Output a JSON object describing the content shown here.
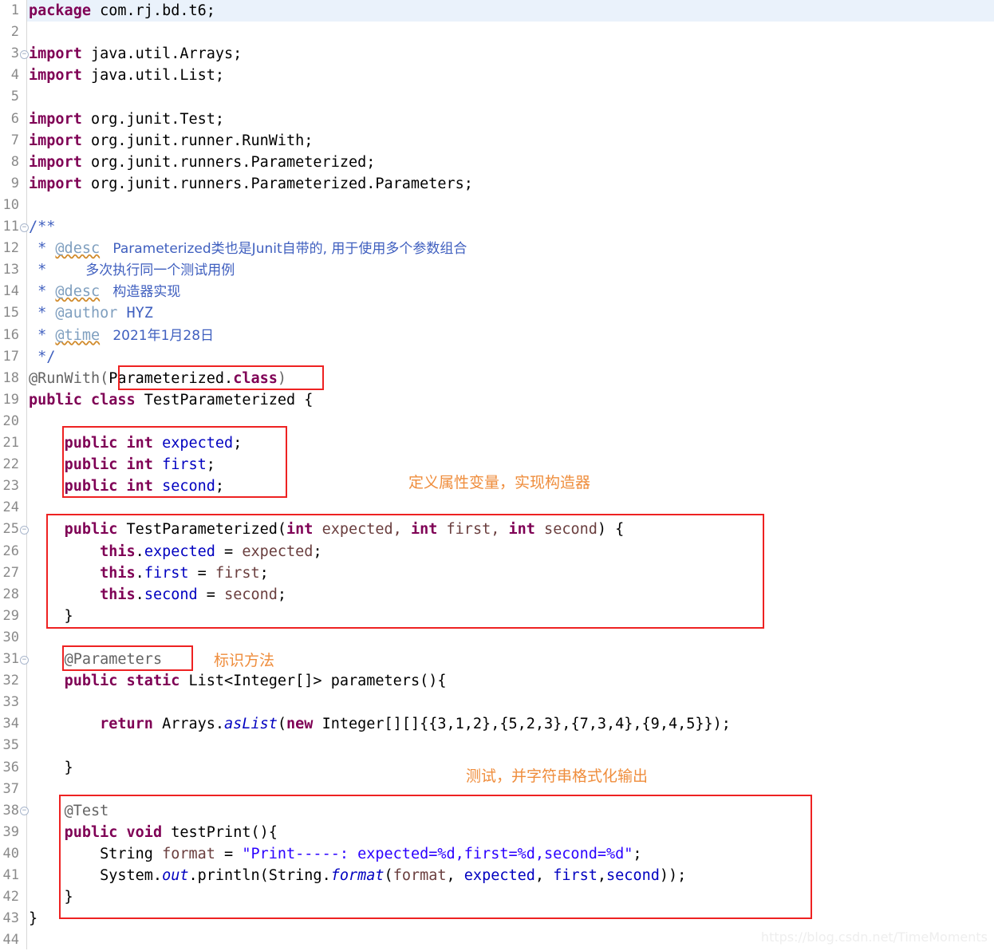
{
  "editor": {
    "language": "java",
    "current_line": 1,
    "total_lines": 44,
    "line_height": 27.1,
    "colors": {
      "keyword": "#7F0055",
      "field": "#0000C0",
      "parameter": "#6A3E3E",
      "string": "#2A00FF",
      "javadoc": "#3F5FBF",
      "javadoc_tag": "#7F9FBF",
      "annotation": "#646464",
      "line_number": "#8A8A8A",
      "current_line_bg": "#EAF2FB",
      "highlight_box": "#EE2222",
      "note_text": "#EF8D3C"
    }
  },
  "line_numbers": [
    1,
    2,
    3,
    4,
    5,
    6,
    7,
    8,
    9,
    10,
    11,
    12,
    13,
    14,
    15,
    16,
    17,
    18,
    19,
    20,
    21,
    22,
    23,
    24,
    25,
    26,
    27,
    28,
    29,
    30,
    31,
    32,
    33,
    34,
    35,
    36,
    37,
    38,
    39,
    40,
    41,
    42,
    43,
    44
  ],
  "fold_markers": [
    3,
    11,
    25,
    31,
    38
  ],
  "code_lines": [
    {
      "n": 1,
      "text": "package com.rj.bd.t6;"
    },
    {
      "n": 2,
      "text": ""
    },
    {
      "n": 3,
      "text": "import java.util.Arrays;"
    },
    {
      "n": 4,
      "text": "import java.util.List;"
    },
    {
      "n": 5,
      "text": ""
    },
    {
      "n": 6,
      "text": "import org.junit.Test;"
    },
    {
      "n": 7,
      "text": "import org.junit.runner.RunWith;"
    },
    {
      "n": 8,
      "text": "import org.junit.runners.Parameterized;"
    },
    {
      "n": 9,
      "text": "import org.junit.runners.Parameterized.Parameters;"
    },
    {
      "n": 10,
      "text": ""
    },
    {
      "n": 11,
      "text": "/**"
    },
    {
      "n": 12,
      "text": " * @desc   Parameterized类也是Junit自带的, 用于使用多个参数组合"
    },
    {
      "n": 13,
      "text": " *        多次执行同一个测试用例"
    },
    {
      "n": 14,
      "text": " * @desc   构造器实现"
    },
    {
      "n": 15,
      "text": " * @author HYZ"
    },
    {
      "n": 16,
      "text": " * @time   2021年1月28日"
    },
    {
      "n": 17,
      "text": " */"
    },
    {
      "n": 18,
      "text": "@RunWith(Parameterized.class)"
    },
    {
      "n": 19,
      "text": "public class TestParameterized {"
    },
    {
      "n": 20,
      "text": ""
    },
    {
      "n": 21,
      "text": "    public int expected;"
    },
    {
      "n": 22,
      "text": "    public int first;"
    },
    {
      "n": 23,
      "text": "    public int second;"
    },
    {
      "n": 24,
      "text": ""
    },
    {
      "n": 25,
      "text": "    public TestParameterized(int expected, int first, int second) {"
    },
    {
      "n": 26,
      "text": "        this.expected = expected;"
    },
    {
      "n": 27,
      "text": "        this.first = first;"
    },
    {
      "n": 28,
      "text": "        this.second = second;"
    },
    {
      "n": 29,
      "text": "    }"
    },
    {
      "n": 30,
      "text": ""
    },
    {
      "n": 31,
      "text": "    @Parameters"
    },
    {
      "n": 32,
      "text": "    public static List<Integer[]> parameters(){"
    },
    {
      "n": 33,
      "text": ""
    },
    {
      "n": 34,
      "text": "        return Arrays.asList(new Integer[][]{{3,1,2},{5,2,3},{7,3,4},{9,4,5}});"
    },
    {
      "n": 35,
      "text": ""
    },
    {
      "n": 36,
      "text": "    }"
    },
    {
      "n": 37,
      "text": ""
    },
    {
      "n": 38,
      "text": "    @Test"
    },
    {
      "n": 39,
      "text": "    public void testPrint(){"
    },
    {
      "n": 40,
      "text": "        String format = \"Print-----: expected=%d,first=%d,second=%d\";"
    },
    {
      "n": 41,
      "text": "        System.out.println(String.format(format, expected, first,second));"
    },
    {
      "n": 42,
      "text": "    }"
    },
    {
      "n": 43,
      "text": "}"
    },
    {
      "n": 44,
      "text": ""
    }
  ],
  "tokens": {
    "l1": {
      "kw": "package",
      "rest": " com.rj.bd.t6;"
    },
    "l3": {
      "kw": "import",
      "rest": " java.util.Arrays;"
    },
    "l4": {
      "kw": "import",
      "rest": " java.util.List;"
    },
    "l6": {
      "kw": "import",
      "rest": " org.junit.Test;"
    },
    "l7": {
      "kw": "import",
      "rest": " org.junit.runner.RunWith;"
    },
    "l8": {
      "kw": "import",
      "rest": " org.junit.runners.Parameterized;"
    },
    "l9": {
      "kw": "import",
      "rest": " org.junit.runners.Parameterized.Parameters;"
    },
    "l11": {
      "open": "/**"
    },
    "l12": {
      "star": " * ",
      "tag": "@desc",
      "body": "   Parameterized类也是Junit自带的, 用于使用多个参数组合"
    },
    "l13": {
      "star": " * ",
      "body": "       多次执行同一个测试用例"
    },
    "l14": {
      "star": " * ",
      "tag": "@desc",
      "body": "   构造器实现"
    },
    "l15": {
      "star": " * ",
      "tag": "@author",
      "body": " HYZ"
    },
    "l16": {
      "star": " * ",
      "tag": "@time",
      "body": "   2021年1月28日"
    },
    "l17": {
      "close": " */"
    },
    "l18": {
      "ann": "@RunWith(",
      "type": "Parameterized.",
      "kw": "class",
      "tail": ")"
    },
    "l19": {
      "kw1": "public",
      "kw2": "class",
      "name": " TestParameterized {"
    },
    "l21": {
      "kw": "public int",
      "name": " expected",
      "semi": ";"
    },
    "l22": {
      "kw": "public int",
      "name": " first",
      "semi": ";"
    },
    "l23": {
      "kw": "public int",
      "name": " second",
      "semi": ";"
    },
    "l25": {
      "kw": "public",
      "ctor": " TestParameterized(",
      "p1kw": "int",
      "p1": " expected, ",
      "p2kw": "int",
      "p2": " first, ",
      "p3kw": "int",
      "p3": " second",
      "tail": ") {"
    },
    "l26": {
      "kw": "this",
      "dot": ".",
      "fld": "expected",
      "mid": " = ",
      "par": "expected",
      "semi": ";"
    },
    "l27": {
      "kw": "this",
      "dot": ".",
      "fld": "first",
      "mid": " = ",
      "par": "first",
      "semi": ";"
    },
    "l28": {
      "kw": "this",
      "dot": ".",
      "fld": "second",
      "mid": " = ",
      "par": "second",
      "semi": ";"
    },
    "l31": {
      "ann": "@Parameters"
    },
    "l32": {
      "kw": "public static",
      "rest": " List<Integer[]> parameters(){"
    },
    "l34": {
      "kw": "return",
      "mid": " Arrays.",
      "stat": "asList",
      "open": "(",
      "kwnew": "new",
      "rest": " Integer[][]{{3,1,2},{5,2,3},{7,3,4},{9,4,5}});"
    },
    "l38": {
      "ann": "@Test"
    },
    "l39": {
      "kw1": "public",
      "kw2": "void",
      "rest": " testPrint(){"
    },
    "l40": {
      "type": "String",
      "var": " format",
      "eq": " = ",
      "str": "\"Print-----: expected=%d,first=%d,second=%d\"",
      "semi": ";"
    },
    "l41": {
      "sys": "System.",
      "out": "out",
      "mid": ".println(String.",
      "fmt": "format",
      "open": "(",
      "arg1": "format",
      "comma1": ", ",
      "arg2": "expected",
      "comma2": ", ",
      "arg3": "first",
      "comma3": ",",
      "arg4": "second",
      "tail": "));"
    },
    "l42": {
      "brace": "    }"
    },
    "l43": {
      "brace": "}"
    }
  },
  "highlight_boxes": [
    {
      "id": "box-runwith-arg",
      "label": "Parameterized.class"
    },
    {
      "id": "box-fields",
      "label": "field declarations"
    },
    {
      "id": "box-constructor",
      "label": "constructor block"
    },
    {
      "id": "box-parameters",
      "label": "@Parameters annotation"
    },
    {
      "id": "box-test-method",
      "label": "test method block"
    }
  ],
  "notes": [
    {
      "id": "note-fields",
      "text": "定义属性变量，实现构造器"
    },
    {
      "id": "note-parameters",
      "text": "标识方法"
    },
    {
      "id": "note-test",
      "text": "测试，并字符串格式化输出"
    }
  ],
  "watermark": {
    "text": "https://blog.csdn.net/TimeMoments"
  }
}
